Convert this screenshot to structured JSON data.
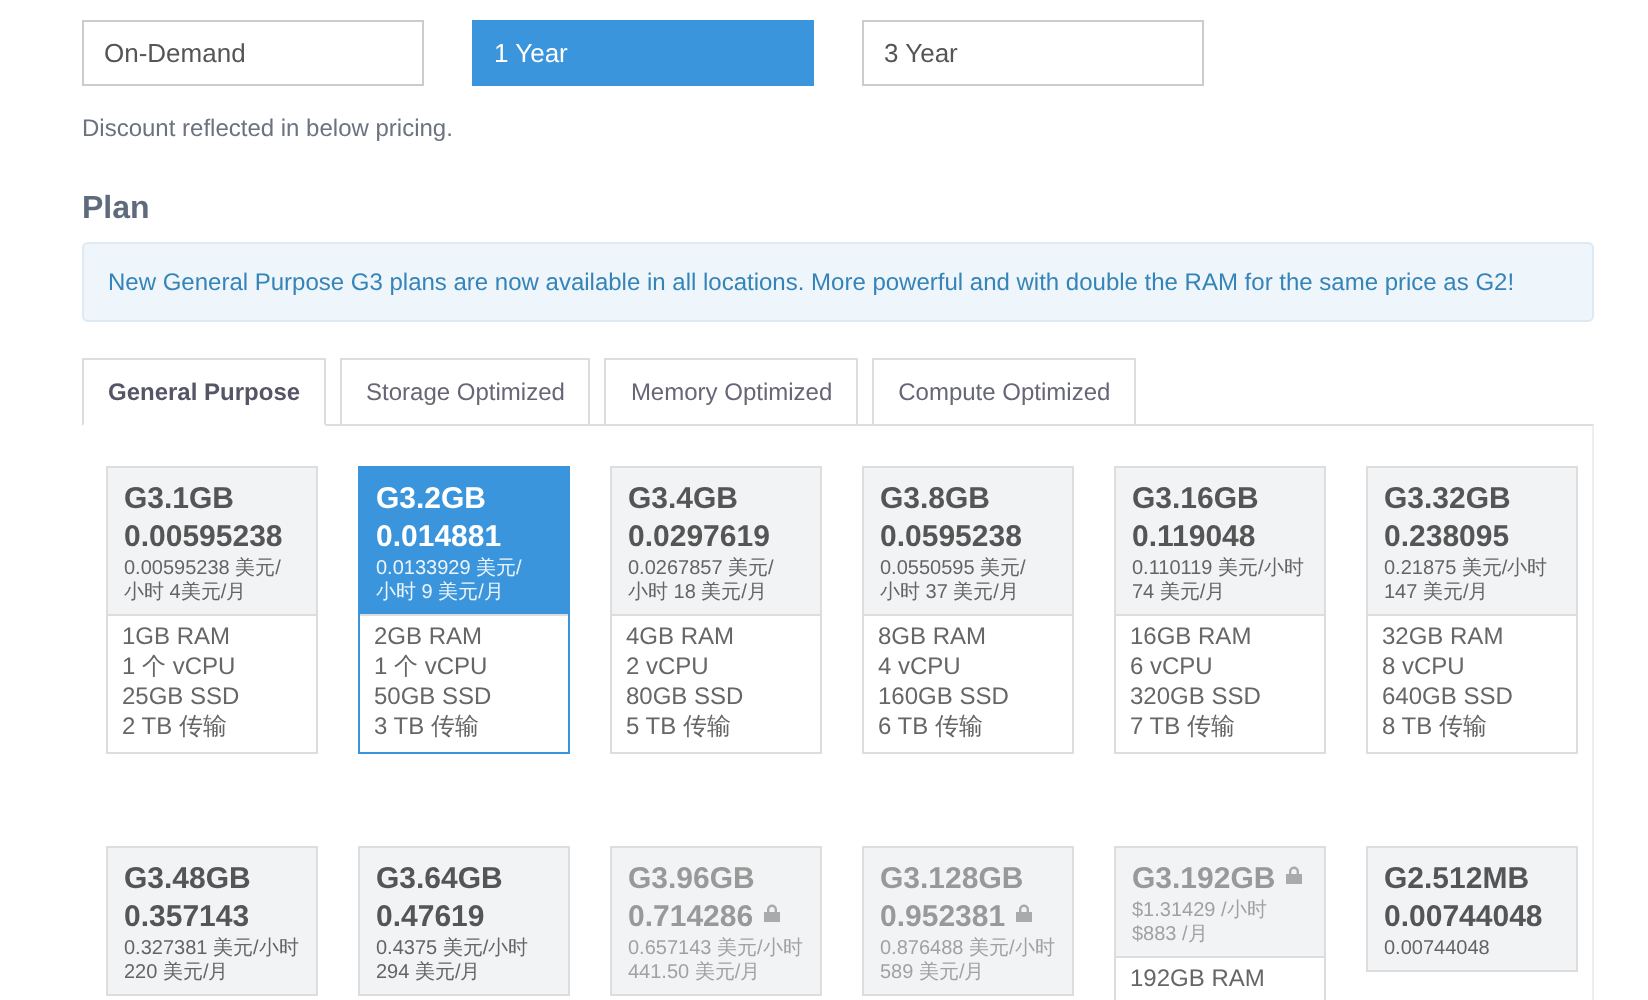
{
  "terms": [
    {
      "label": "On-Demand",
      "selected": false
    },
    {
      "label": "1 Year",
      "selected": true
    },
    {
      "label": "3 Year",
      "selected": false
    }
  ],
  "discount_note": "Discount reflected in below pricing.",
  "plan": {
    "heading": "Plan",
    "notice": "New General Purpose G3 plans are now available in all locations. More powerful and with double the RAM for the same price as G2!",
    "tabs": [
      {
        "label": "General Purpose",
        "selected": true
      },
      {
        "label": "Storage Optimized",
        "selected": false
      },
      {
        "label": "Memory Optimized",
        "selected": false
      },
      {
        "label": "Compute Optimized",
        "selected": false
      }
    ],
    "cards": [
      {
        "name": "G3.1GB",
        "price": "0.00595238",
        "sub": "0.00595238 美元/小时 4美元/月",
        "selected": false,
        "locked": false,
        "specs": [
          "1GB RAM",
          "1 个 vCPU",
          "25GB SSD",
          "2 TB 传输"
        ]
      },
      {
        "name": "G3.2GB",
        "price": "0.014881",
        "sub": "0.0133929 美元/小时 9 美元/月",
        "selected": true,
        "locked": false,
        "specs": [
          "2GB RAM",
          "1 个 vCPU",
          "50GB SSD",
          "3 TB 传输"
        ]
      },
      {
        "name": "G3.4GB",
        "price": "0.0297619",
        "sub": "0.0267857 美元/小时 18 美元/月",
        "selected": false,
        "locked": false,
        "specs": [
          "4GB RAM",
          "2 vCPU",
          "80GB SSD",
          "5 TB 传输"
        ]
      },
      {
        "name": "G3.8GB",
        "price": "0.0595238",
        "sub": "0.0550595 美元/小时 37 美元/月",
        "selected": false,
        "locked": false,
        "specs": [
          "8GB RAM",
          "4 vCPU",
          "160GB SSD",
          "6 TB 传输"
        ]
      },
      {
        "name": "G3.16GB",
        "price": "0.119048",
        "sub": "0.110119 美元/小时 74 美元/月",
        "selected": false,
        "locked": false,
        "specs": [
          "16GB RAM",
          "6 vCPU",
          "320GB SSD",
          "7 TB 传输"
        ]
      },
      {
        "name": "G3.32GB",
        "price": "0.238095",
        "sub": "0.21875 美元/小时 147 美元/月",
        "selected": false,
        "locked": false,
        "specs": [
          "32GB RAM",
          "8 vCPU",
          "640GB SSD",
          "8 TB 传输"
        ]
      },
      {
        "name": "G3.48GB",
        "price": "0.357143",
        "sub": "0.327381 美元/小时 220 美元/月",
        "selected": false,
        "locked": false
      },
      {
        "name": "G3.64GB",
        "price": "0.47619",
        "sub": "0.4375 美元/小时 294 美元/月",
        "selected": false,
        "locked": false
      },
      {
        "name": "G3.96GB",
        "price": "0.714286",
        "sub": "0.657143 美元/小时 441.50 美元/月",
        "selected": false,
        "locked": true
      },
      {
        "name": "G3.128GB",
        "price": "0.952381",
        "sub": "0.876488 美元/小时 589 美元/月",
        "selected": false,
        "locked": true
      },
      {
        "name": "G3.192GB",
        "sub": "$1.31429 /小时 $883 /月",
        "selected": false,
        "locked": true,
        "specs": [
          "192GB RAM"
        ]
      },
      {
        "name": "G2.512MB",
        "price": "0.00744048",
        "sub": "0.00744048",
        "selected": false,
        "locked": false
      }
    ]
  }
}
